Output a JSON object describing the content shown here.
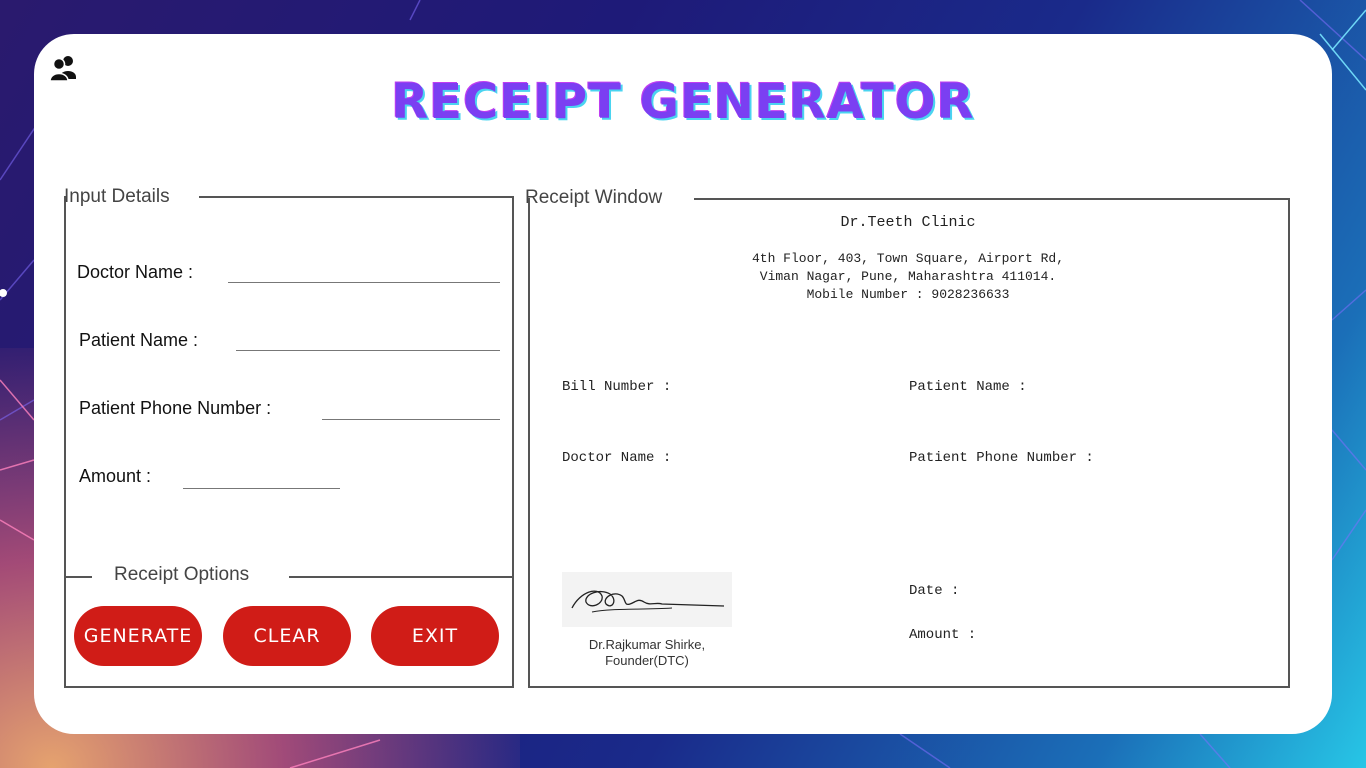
{
  "app": {
    "title": "RECEIPT GENERATOR",
    "title_color": "#7b3ff2",
    "title_shadow_color": "#4ad4f0"
  },
  "icons": {
    "users": "users-icon"
  },
  "input_panel": {
    "legend": "Input Details",
    "fields": [
      {
        "label": "Doctor Name :",
        "value": ""
      },
      {
        "label": "Patient Name :",
        "value": ""
      },
      {
        "label": "Patient Phone Number :",
        "value": ""
      },
      {
        "label": "Amount :",
        "value": ""
      }
    ]
  },
  "options_panel": {
    "legend": "Receipt Options",
    "buttons": [
      {
        "label": "GENERATE"
      },
      {
        "label": "CLEAR"
      },
      {
        "label": "EXIT"
      }
    ],
    "button_color": "#d01c17"
  },
  "receipt": {
    "legend": "Receipt Window",
    "clinic_name": "Dr.Teeth Clinic",
    "address_line1": "4th Floor, 403, Town Square, Airport Rd,",
    "address_line2": "Viman Nagar, Pune, Maharashtra 411014.",
    "mobile": "Mobile Number : 9028236633",
    "bill_number_label": "Bill Number :",
    "patient_name_label": "Patient Name :",
    "doctor_name_label": "Doctor Name :",
    "patient_phone_label": "Patient Phone Number :",
    "date_label": "Date :",
    "amount_label": "Amount :",
    "signer_name": "Dr.Rajkumar Shirke,",
    "signer_title": "Founder(DTC)"
  }
}
